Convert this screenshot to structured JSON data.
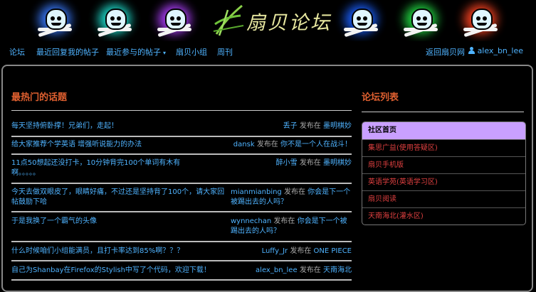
{
  "banner": {
    "logo_text": "扇贝论坛",
    "skull_colors": [
      "#3a7bff",
      "#1fe0d0",
      "#b040ff",
      "#1a60ff",
      "#22dd44",
      "#ff4422"
    ]
  },
  "nav": {
    "items": [
      {
        "label": "论坛"
      },
      {
        "label": "最近回复我的帖子"
      },
      {
        "label": "最近参与的帖子"
      },
      {
        "label": "扇贝小组"
      },
      {
        "label": "周刊"
      }
    ],
    "dropdown_caret": "▾",
    "back_link": "返回扇贝网",
    "username": "alex_bn_lee"
  },
  "hot_topics": {
    "title": "最热门的话题",
    "by_word": "发布在",
    "items": [
      {
        "title": "每天坚持俯卧撑！兄弟们，走起！",
        "author": "丢子",
        "forum": "墨明棋妙"
      },
      {
        "title": "给大家推荐个学英语 增强听说能力的办法",
        "author": "dansk",
        "forum": "你不是一个人在战斗！"
      },
      {
        "title": "11点50想起还没打卡，10分钟背完100个单词有木有啊。。。。。",
        "author": "醉小雪",
        "forum": "墨明棋妙"
      },
      {
        "title": "今天去做双眼皮了，眼睛好痛，不过还是坚持背了100个，请大家回帖鼓励下哈",
        "author": "mianmianbing",
        "forum": "你会是下一个被踢出去的人吗？"
      },
      {
        "title": "于是我换了一个霸气的头像",
        "author": "wynnechan",
        "forum": "你会是下一个被踢出去的人吗？"
      },
      {
        "title": "什么时候咱们小组能满员，且打卡率达到85%啊？？？",
        "author": "Luffy_Jr",
        "forum": "ONE PIECE"
      },
      {
        "title": "自己为Shanbay在Firefox的Stylish中写了个代码，欢迎下载！",
        "author": "alex_bn_lee",
        "forum": "天南海北"
      }
    ]
  },
  "forum_list": {
    "title": "论坛列表",
    "items": [
      {
        "label": "社区首页",
        "active": true
      },
      {
        "label": "集思广益(使用答疑区)"
      },
      {
        "label": "扇贝手机版"
      },
      {
        "label": "英语学苑(英语学习区)"
      },
      {
        "label": "扇贝阅读"
      },
      {
        "label": "天南海北(灌水区)"
      }
    ]
  }
}
